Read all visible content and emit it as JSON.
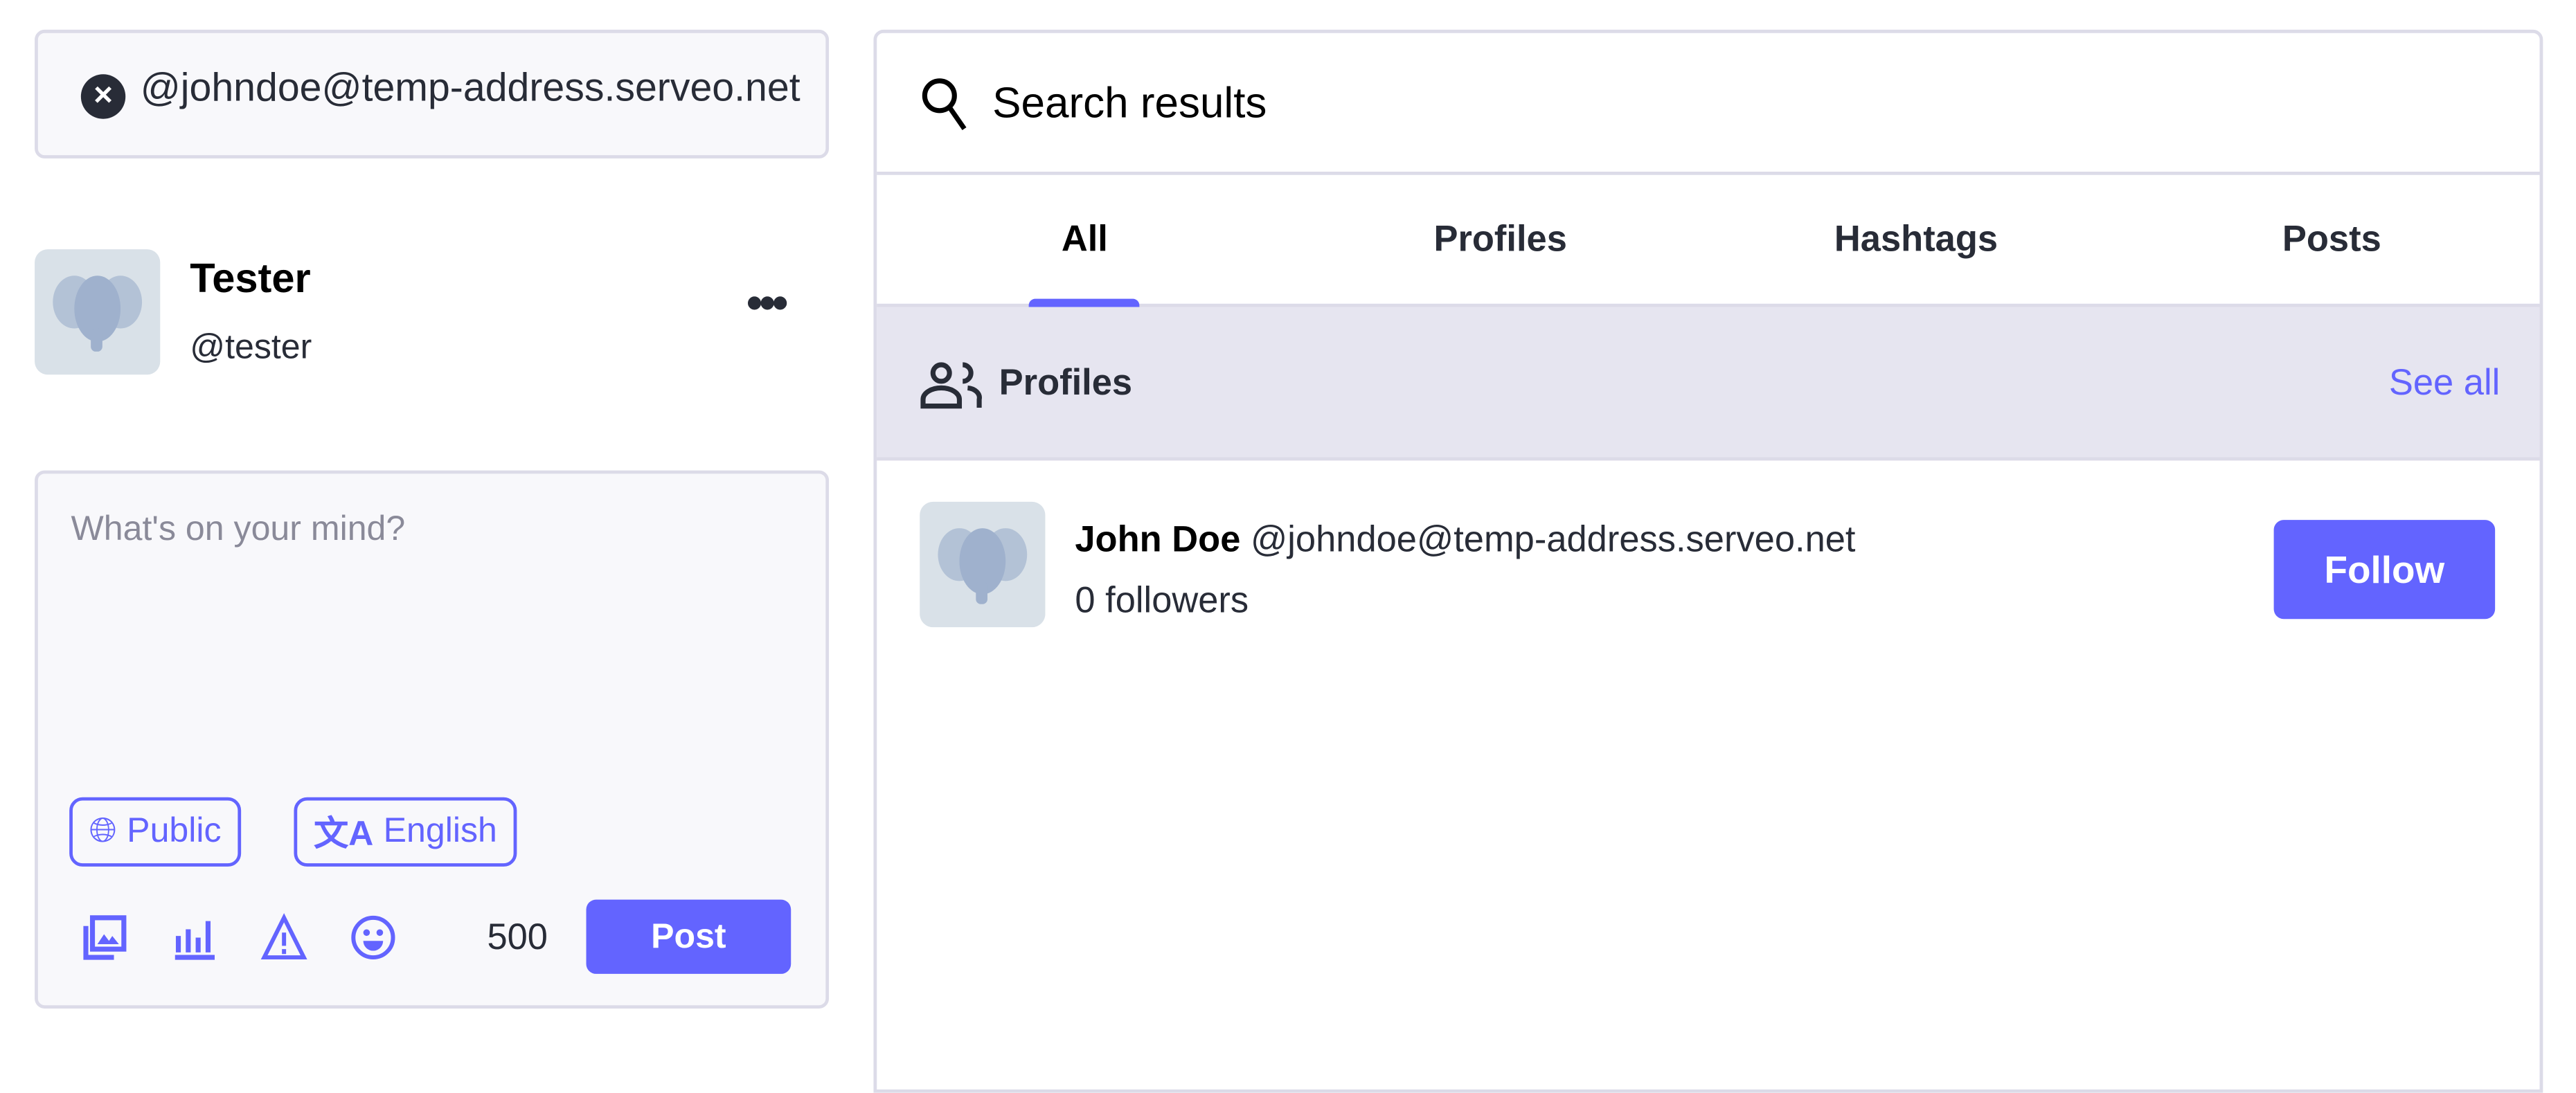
{
  "search": {
    "value": "@johndoe@temp-address.serveo.net",
    "clear_icon": "close-circle-icon"
  },
  "current_user": {
    "display_name": "Tester",
    "handle": "@tester",
    "menu_icon": "more-horizontal-icon"
  },
  "compose": {
    "placeholder": "What's on your mind?",
    "visibility_label": "Public",
    "language_label": "English",
    "tool_icons": [
      "image-icon",
      "poll-icon",
      "warning-icon",
      "emoji-icon"
    ],
    "char_count": "500",
    "post_label": "Post"
  },
  "results": {
    "title": "Search results",
    "tabs": [
      {
        "label": "All",
        "active": true
      },
      {
        "label": "Profiles"
      },
      {
        "label": "Hashtags"
      },
      {
        "label": "Posts"
      }
    ],
    "section_title": "Profiles",
    "see_all": "See all",
    "accounts": [
      {
        "name": "John Doe",
        "handle": "@johndoe@temp-address.serveo.net",
        "followers": "0 followers",
        "follow_label": "Follow"
      }
    ]
  },
  "colors": {
    "accent": "#6364ff",
    "border": "#dcdbe8",
    "section_bg": "#e6e5f0",
    "text": "#282c37"
  }
}
